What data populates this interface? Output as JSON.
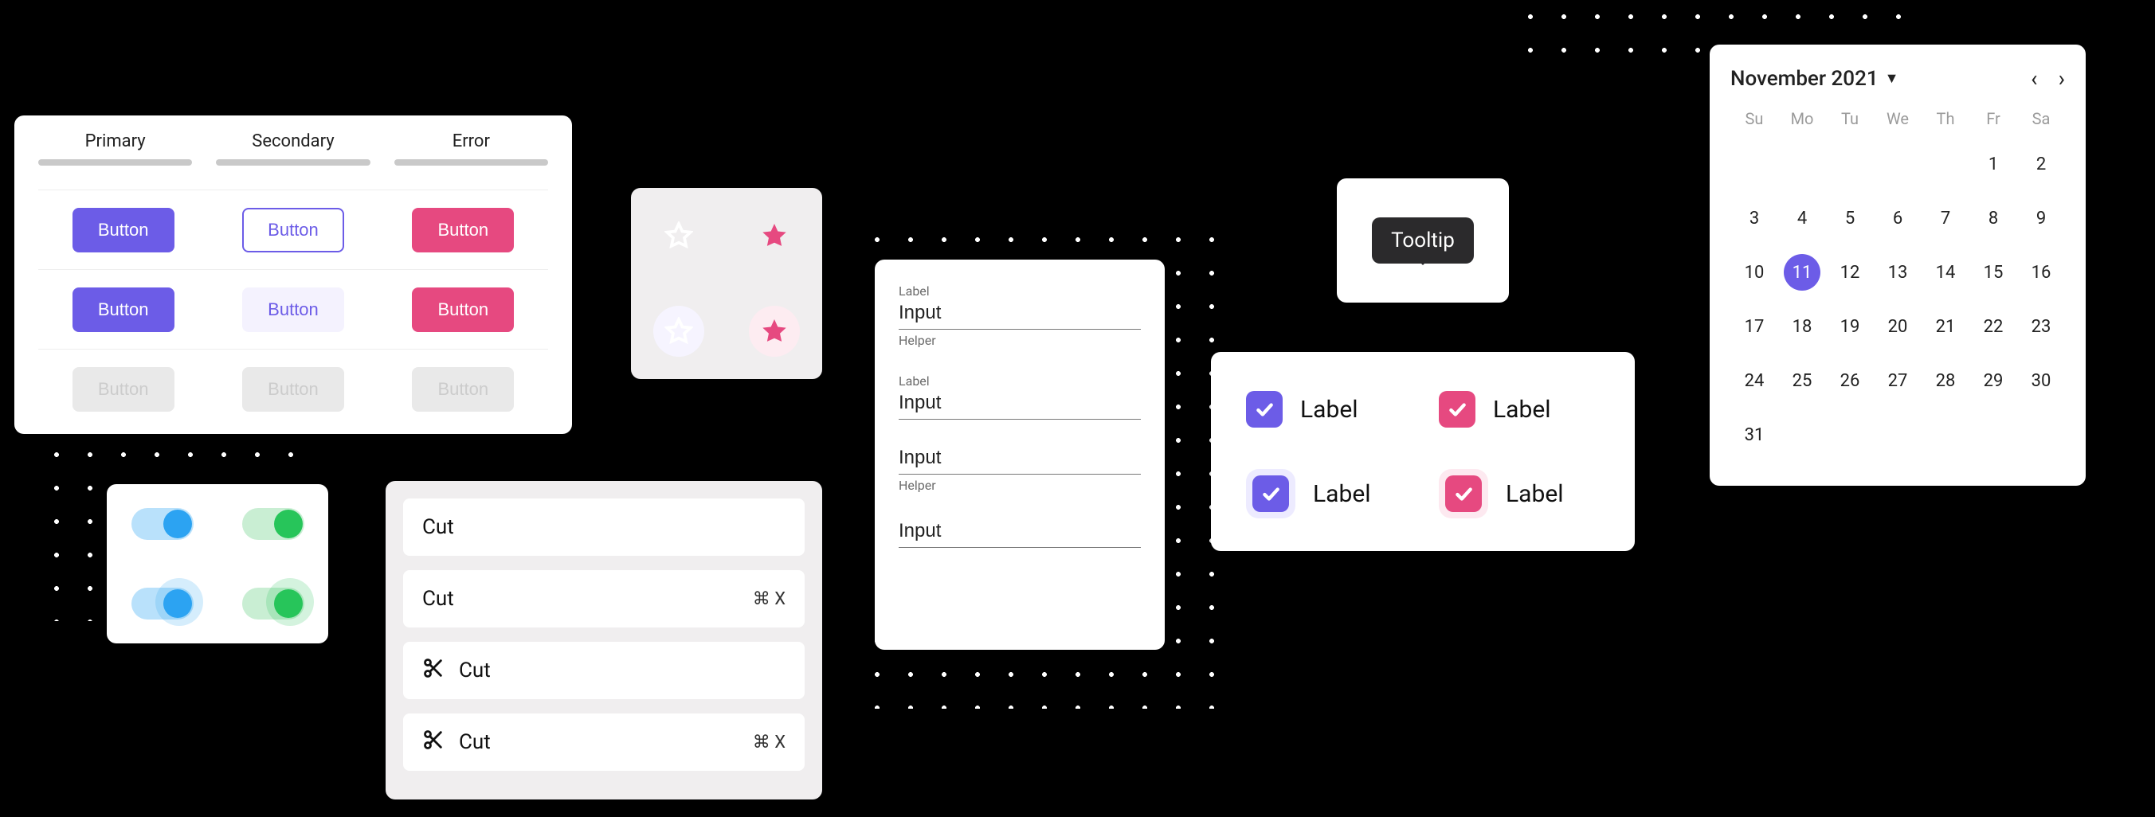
{
  "buttons": {
    "tabs": [
      "Primary",
      "Secondary",
      "Error"
    ],
    "rows": [
      {
        "primary": "Button",
        "secondary": "Button",
        "error": "Button"
      },
      {
        "primary": "Button",
        "secondary": "Button",
        "error": "Button"
      },
      {
        "primary": "Button",
        "secondary": "Button",
        "error": "Button"
      }
    ]
  },
  "inputs": {
    "items": [
      {
        "label": "Label",
        "value": "Input",
        "helper": "Helper"
      },
      {
        "label": "Label",
        "value": "Input",
        "helper": ""
      },
      {
        "label": "",
        "value": "Input",
        "helper": "Helper"
      },
      {
        "label": "",
        "value": "Input",
        "helper": ""
      }
    ]
  },
  "tooltip": {
    "text": "Tooltip"
  },
  "checkbox": {
    "items": [
      {
        "label": "Label"
      },
      {
        "label": "Label"
      },
      {
        "label": "Label"
      },
      {
        "label": "Label"
      }
    ]
  },
  "calendar": {
    "title": "November 2021",
    "dow": [
      "Su",
      "Mo",
      "Tu",
      "We",
      "Th",
      "Fr",
      "Sa"
    ],
    "leading_blanks": 5,
    "days": 31,
    "selected": 11
  },
  "menu": {
    "items": [
      {
        "label": "Cut",
        "icon": false,
        "shortcut": ""
      },
      {
        "label": "Cut",
        "icon": false,
        "shortcut": "⌘ X"
      },
      {
        "label": "Cut",
        "icon": true,
        "shortcut": ""
      },
      {
        "label": "Cut",
        "icon": true,
        "shortcut": "⌘ X"
      }
    ]
  }
}
